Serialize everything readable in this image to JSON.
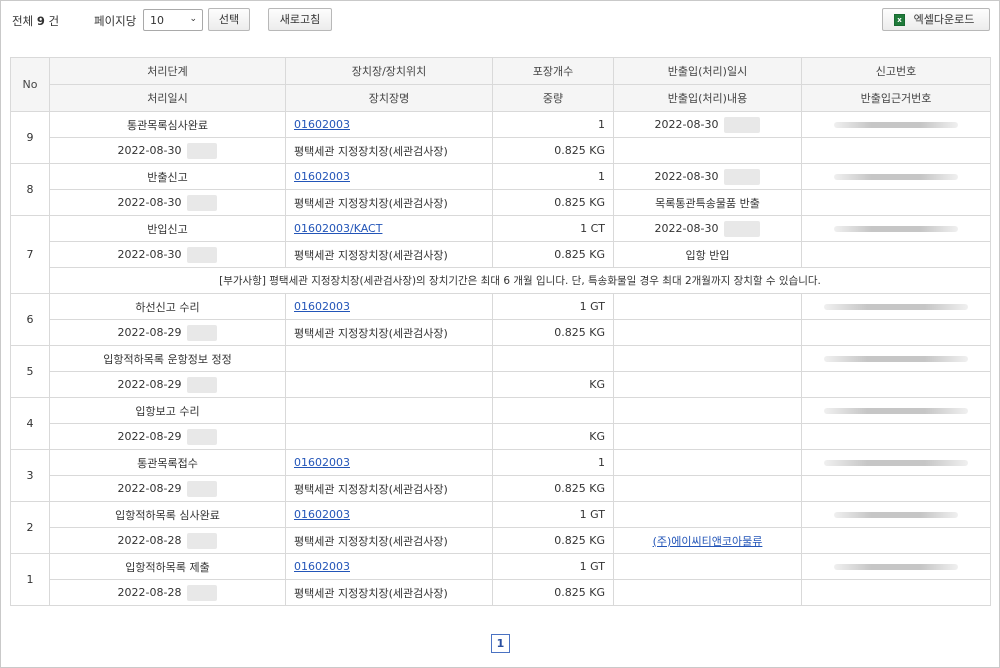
{
  "summary": {
    "total_prefix": "전체",
    "total_count": "9",
    "total_suffix": "건"
  },
  "controls": {
    "perpage_label": "페이지당",
    "perpage_value": "10",
    "select_button": "선택",
    "refresh_button": "새로고침",
    "excel_button": "엑셀다운로드"
  },
  "header": {
    "no": "No",
    "row1": [
      "처리단계",
      "장치장/장치위치",
      "포장개수",
      "반출입(처리)일시",
      "신고번호"
    ],
    "row2": [
      "처리일시",
      "장치장명",
      "중량",
      "반출입(처리)내용",
      "반출입근거번호"
    ]
  },
  "rows": [
    {
      "no": "9",
      "stage": "통관목록심사완료",
      "location": "01602003",
      "packages": "1",
      "inout_datetime": "2022-08-30",
      "processed_date": "2022-08-30",
      "warehouse": "평택세관 지정장치장(세관검사장)",
      "weight": "0.825 KG",
      "inout_content": ""
    },
    {
      "no": "8",
      "stage": "반출신고",
      "location": "01602003",
      "packages": "1",
      "inout_datetime": "2022-08-30",
      "processed_date": "2022-08-30",
      "warehouse": "평택세관 지정장치장(세관검사장)",
      "weight": "0.825 KG",
      "inout_content": "목록통관특송물품 반출"
    },
    {
      "no": "7",
      "stage": "반입신고",
      "location": "01602003/KACT",
      "packages": "1 CT",
      "inout_datetime": "2022-08-30",
      "processed_date": "2022-08-30",
      "warehouse": "평택세관 지정장치장(세관검사장)",
      "weight": "0.825 KG",
      "inout_content": "입항 반입",
      "note": "[부가사항] 평택세관 지정장치장(세관검사장)의 장치기간은 최대 6 개월 입니다. 단, 특송화물일 경우 최대 2개월까지 장치할 수 있습니다."
    },
    {
      "no": "6",
      "stage": "하선신고 수리",
      "location": "01602003",
      "packages": "1 GT",
      "inout_datetime": "",
      "processed_date": "2022-08-29",
      "warehouse": "평택세관 지정장치장(세관검사장)",
      "weight": "0.825 KG",
      "inout_content": ""
    },
    {
      "no": "5",
      "stage": "입항적하목록 운항정보 정정",
      "location": "",
      "packages": "",
      "inout_datetime": "",
      "processed_date": "2022-08-29",
      "warehouse": "",
      "weight": "KG",
      "inout_content": ""
    },
    {
      "no": "4",
      "stage": "입항보고 수리",
      "location": "",
      "packages": "",
      "inout_datetime": "",
      "processed_date": "2022-08-29",
      "warehouse": "",
      "weight": "KG",
      "inout_content": ""
    },
    {
      "no": "3",
      "stage": "통관목록접수",
      "location": "01602003",
      "packages": "1",
      "inout_datetime": "",
      "processed_date": "2022-08-29",
      "warehouse": "평택세관 지정장치장(세관검사장)",
      "weight": "0.825 KG",
      "inout_content": ""
    },
    {
      "no": "2",
      "stage": "입항적하목록 심사완료",
      "location": "01602003",
      "packages": "1 GT",
      "inout_datetime": "",
      "processed_date": "2022-08-28",
      "warehouse": "평택세관 지정장치장(세관검사장)",
      "weight": "0.825 KG",
      "inout_content": "(주)에이씨티앤코아물류"
    },
    {
      "no": "1",
      "stage": "입항적하목록 제출",
      "location": "01602003",
      "packages": "1 GT",
      "inout_datetime": "",
      "processed_date": "2022-08-28",
      "warehouse": "평택세관 지정장치장(세관검사장)",
      "weight": "0.825 KG",
      "inout_content": ""
    }
  ],
  "pagination": {
    "current": "1"
  }
}
